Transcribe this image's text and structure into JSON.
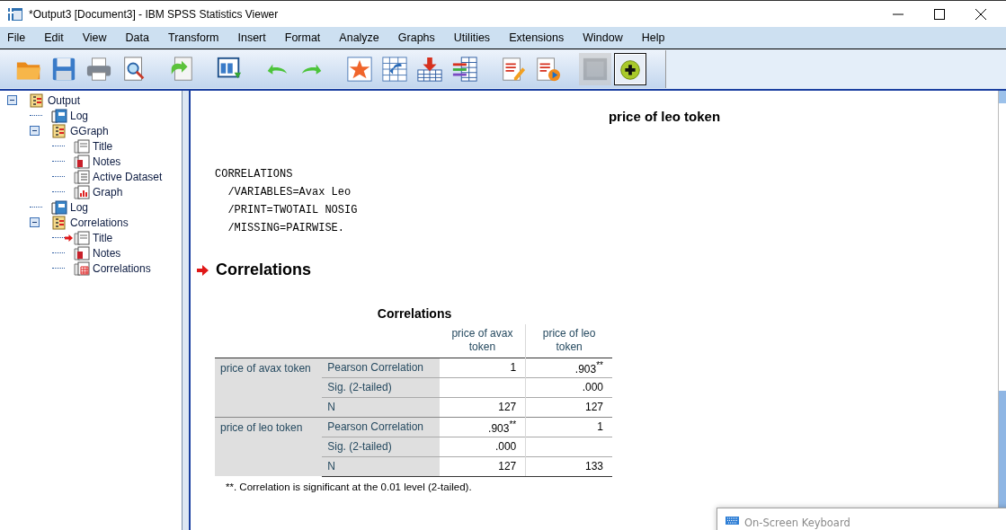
{
  "window": {
    "title": "*Output3 [Document3] - IBM SPSS Statistics Viewer"
  },
  "menu": [
    "File",
    "Edit",
    "View",
    "Data",
    "Transform",
    "Insert",
    "Format",
    "Analyze",
    "Graphs",
    "Utilities",
    "Extensions",
    "Window",
    "Help"
  ],
  "toolbar": [
    [
      {
        "kind": "open",
        "disabled": false,
        "selected": false
      },
      {
        "kind": "save",
        "disabled": false,
        "selected": false
      },
      {
        "kind": "print",
        "disabled": false,
        "selected": false
      },
      {
        "kind": "preview",
        "disabled": false,
        "selected": false
      }
    ],
    [
      {
        "kind": "export",
        "disabled": false,
        "selected": false
      }
    ],
    [
      {
        "kind": "goto_data",
        "disabled": false,
        "selected": false
      }
    ],
    [
      {
        "kind": "undo",
        "disabled": false,
        "selected": false
      },
      {
        "kind": "redo",
        "disabled": false,
        "selected": false
      }
    ],
    [
      {
        "kind": "star_table",
        "disabled": false,
        "selected": false
      },
      {
        "kind": "goto_case",
        "disabled": false,
        "selected": false
      },
      {
        "kind": "import",
        "disabled": false,
        "selected": false
      },
      {
        "kind": "variables",
        "disabled": false,
        "selected": false
      }
    ],
    [
      {
        "kind": "designate",
        "disabled": false,
        "selected": false
      },
      {
        "kind": "run",
        "disabled": false,
        "selected": false
      }
    ],
    [
      {
        "kind": "blank",
        "disabled": true,
        "selected": false
      },
      {
        "kind": "add",
        "disabled": false,
        "selected": true
      }
    ]
  ],
  "tree": [
    {
      "label": "Output",
      "kind": "folder",
      "expanded": true,
      "current": false,
      "children": [
        {
          "label": "Log",
          "kind": "log",
          "current": false
        },
        {
          "label": "GGraph",
          "kind": "folder",
          "expanded": true,
          "current": false,
          "children": [
            {
              "label": "Title",
              "kind": "title",
              "current": false
            },
            {
              "label": "Notes",
              "kind": "notes",
              "current": false
            },
            {
              "label": "Active Dataset",
              "kind": "dataset",
              "current": false
            },
            {
              "label": "Graph",
              "kind": "graph",
              "current": false
            }
          ]
        },
        {
          "label": "Log",
          "kind": "log",
          "current": false
        },
        {
          "label": "Correlations",
          "kind": "folder",
          "expanded": true,
          "current": false,
          "children": [
            {
              "label": "Title",
              "kind": "title",
              "current": true
            },
            {
              "label": "Notes",
              "kind": "notes",
              "current": false
            },
            {
              "label": "Correlations",
              "kind": "table",
              "current": false
            }
          ]
        }
      ]
    }
  ],
  "output": {
    "chart_title": "price of leo token",
    "syntax": [
      "CORRELATIONS",
      "  /VARIABLES=Avax Leo",
      "  /PRINT=TWOTAIL NOSIG",
      "  /MISSING=PAIRWISE."
    ],
    "heading": "Correlations",
    "heading_current": true,
    "table": {
      "title": "Correlations",
      "columns": [
        "price of avax token",
        "price of leo token"
      ],
      "groups": [
        {
          "label": "price of avax token",
          "rows": [
            {
              "stat": "Pearson Correlation",
              "column_1": "1",
              "column_2": ".903$^{**}$"
            },
            {
              "stat": "Sig. (2-tailed)",
              "column_2": ".000"
            },
            {
              "stat": "N",
              "column_1": "127",
              "column_2": "127"
            }
          ]
        },
        {
          "label": "price of leo token",
          "rows": [
            {
              "stat": "Pearson Correlation",
              "column_1": ".903$^{**}$",
              "column_2": "1"
            },
            {
              "stat": "Sig. (2-tailed)",
              "column_1": ".000"
            },
            {
              "stat": "N",
              "column_1": "127",
              "column_2": "133"
            }
          ]
        }
      ],
      "footnote": "**. Correlation is significant at the 0.01 level (2-tailed)."
    }
  },
  "keyboard_window": {
    "title": "On-Screen Keyboard"
  }
}
